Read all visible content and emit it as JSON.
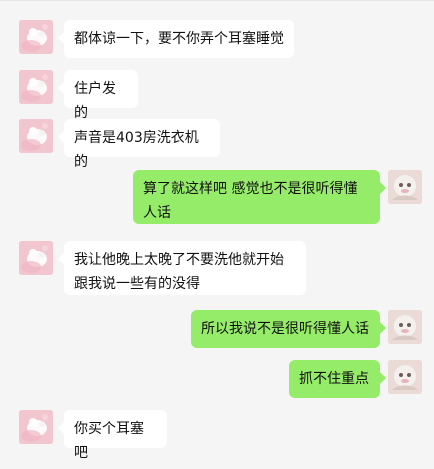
{
  "colors": {
    "background": "#f5f5f5",
    "bubble_left": "#ffffff",
    "bubble_right": "#95ec69",
    "text": "#111111"
  },
  "messages": [
    {
      "side": "left",
      "text": "都体谅一下，要不你弄个耳塞睡觉"
    },
    {
      "side": "left",
      "text": "住户发的"
    },
    {
      "side": "left",
      "text": "声音是403房洗衣机的"
    },
    {
      "side": "right",
      "text": "算了就这样吧 感觉也不是很听得懂人话"
    },
    {
      "side": "left",
      "text": "我让他晚上太晚了不要洗他就开始跟我说一些有的没得"
    },
    {
      "side": "right",
      "text": "所以我说不是很听得懂人话"
    },
    {
      "side": "right",
      "text": "抓不住重点"
    },
    {
      "side": "left",
      "text": "你买个耳塞吧"
    }
  ],
  "avatars": {
    "left_icon": "user-avatar",
    "right_icon": "self-avatar"
  }
}
